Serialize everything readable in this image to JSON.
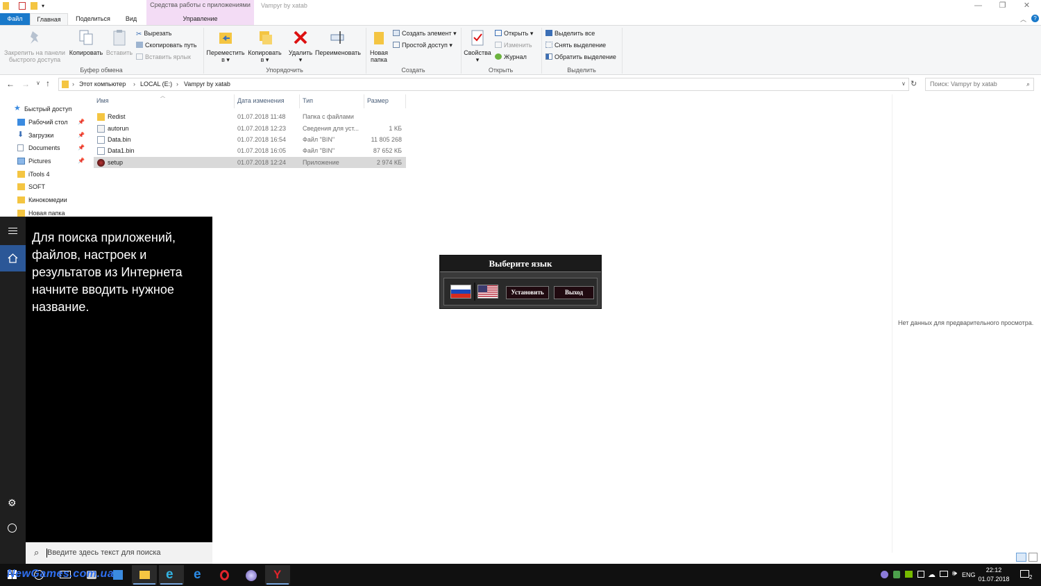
{
  "window": {
    "title": "Vampyr by xatab",
    "context_group": "Средства работы с приложениями",
    "context_tab": "Управление",
    "controls": [
      "—",
      "❐",
      "✕"
    ]
  },
  "tabs": [
    "Файл",
    "Главная",
    "Поделиться",
    "Вид"
  ],
  "ribbon": {
    "clipboard": {
      "label": "Буфер обмена",
      "pin_line1": "Закрепить на панели",
      "pin_line2": "быстрого доступа",
      "copy": "Копировать",
      "paste": "Вставить",
      "cut": "Вырезать",
      "copy_path": "Скопировать путь",
      "paste_shortcut": "Вставить ярлык"
    },
    "organize": {
      "label": "Упорядочить",
      "move_line1": "Переместить",
      "move_line2": "в ▾",
      "copy_line1": "Копировать",
      "copy_line2": "в ▾",
      "delete_line1": "Удалить",
      "delete_line2": "▾",
      "rename": "Переименовать"
    },
    "create": {
      "label": "Создать",
      "new_folder_line1": "Новая",
      "new_folder_line2": "папка",
      "new_item": "Создать элемент ▾",
      "easy_access": "Простой доступ ▾"
    },
    "open": {
      "label": "Открыть",
      "properties_line1": "Свойства",
      "properties_line2": "▾",
      "open": "Открыть ▾",
      "edit": "Изменить",
      "history": "Журнал"
    },
    "select": {
      "label": "Выделить",
      "select_all": "Выделить все",
      "select_none": "Снять выделение",
      "invert": "Обратить выделение"
    }
  },
  "address": {
    "crumbs": [
      "Этот компьютер",
      "LOCAL (E:)",
      "Vampyr by xatab"
    ],
    "search_placeholder": "Поиск: Vampyr by xatab"
  },
  "nav": {
    "quick_access": "Быстрый доступ",
    "items": [
      "Рабочий стол",
      "Загрузки",
      "Documents",
      "Pictures",
      "iTools 4",
      "SOFT",
      "Кинокомедии",
      "Новая папка"
    ]
  },
  "columns": [
    "Имя",
    "Дата изменения",
    "Тип",
    "Размер"
  ],
  "files": [
    {
      "name": "Redist",
      "date": "01.07.2018 11:48",
      "type": "Папка с файлами",
      "size": ""
    },
    {
      "name": "autorun",
      "date": "01.07.2018 12:23",
      "type": "Сведения для уст...",
      "size": "1 КБ"
    },
    {
      "name": "Data.bin",
      "date": "01.07.2018 16:54",
      "type": "Файл \"BIN\"",
      "size": "11 805 268"
    },
    {
      "name": "Data1.bin",
      "date": "01.07.2018 16:05",
      "type": "Файл \"BIN\"",
      "size": "87 652 КБ"
    },
    {
      "name": "setup",
      "date": "01.07.2018 12:24",
      "type": "Приложение",
      "size": "2 974 КБ"
    }
  ],
  "preview": {
    "empty_text": "Нет данных для предварительного просмотра."
  },
  "start": {
    "hint": "Для поиска приложений, файлов, настроек и результатов из Интернета начните вводить нужное название.",
    "search_placeholder": "Введите здесь текст для поиска"
  },
  "dialog": {
    "title": "Выберите язык",
    "install": "Установить",
    "exit": "Выход"
  },
  "tray": {
    "lang": "ENG",
    "time": "22:12",
    "date": "01.07.2018",
    "notif": "2"
  },
  "watermark": "NewGames.com.ua",
  "colors": {
    "accent": "#1979ca",
    "context": "#f3dcf5",
    "selected_row": "#d9d9d9",
    "start_bg": "#000000",
    "taskbar": "#101010"
  }
}
